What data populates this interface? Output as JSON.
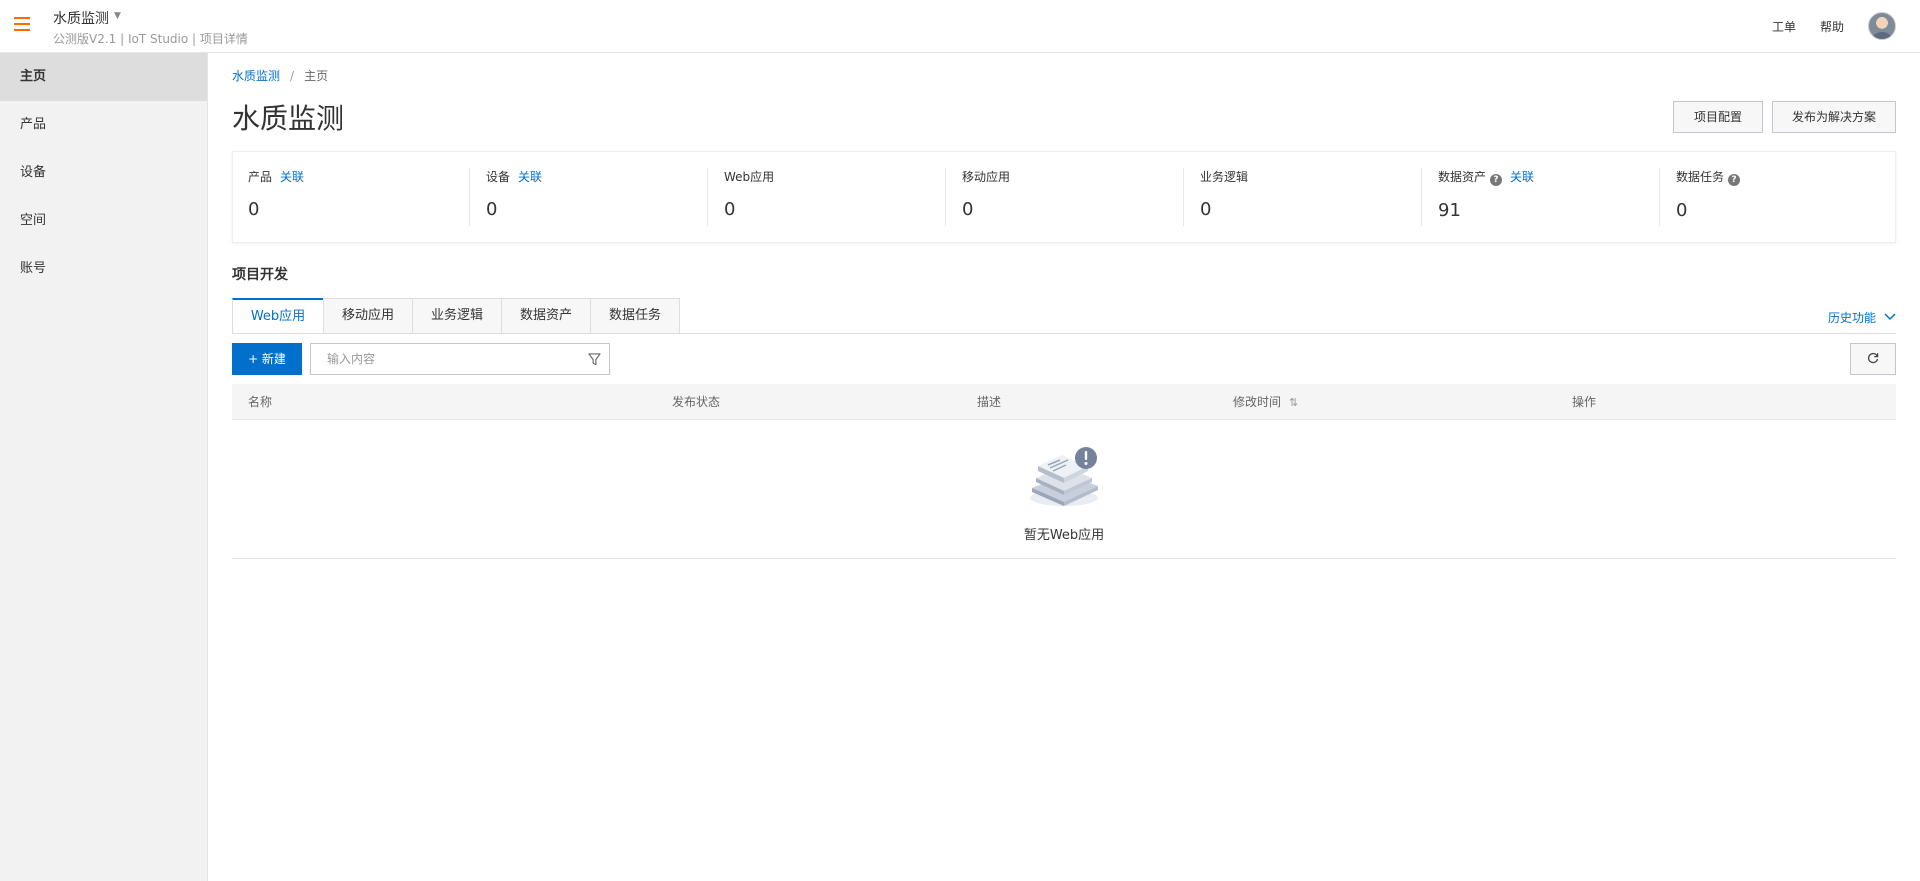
{
  "header": {
    "project_name": "水质监测",
    "project_subtitle": "公测版V2.1 | IoT Studio | 项目详情",
    "ticket_label": "工单",
    "help_label": "帮助",
    "brand_color": "#ff6a00"
  },
  "sidebar": {
    "items": [
      {
        "label": "主页",
        "active": true
      },
      {
        "label": "产品"
      },
      {
        "label": "设备"
      },
      {
        "label": "空间"
      },
      {
        "label": "账号"
      }
    ]
  },
  "breadcrumb": {
    "parent": "水质监测",
    "separator": "/",
    "current": "主页"
  },
  "page": {
    "title": "水质监测",
    "config_button": "项目配置",
    "publish_button": "发布为解决方案"
  },
  "stats": [
    {
      "label": "产品",
      "link": "关联",
      "value": "0"
    },
    {
      "label": "设备",
      "link": "关联",
      "value": "0"
    },
    {
      "label": "Web应用",
      "value": "0"
    },
    {
      "label": "移动应用",
      "value": "0"
    },
    {
      "label": "业务逻辑",
      "value": "0"
    },
    {
      "label": "数据资产",
      "help": true,
      "link": "关联",
      "value": "91"
    },
    {
      "label": "数据任务",
      "help": true,
      "value": "0"
    }
  ],
  "development": {
    "section_title": "项目开发",
    "tabs": [
      "Web应用",
      "移动应用",
      "业务逻辑",
      "数据资产",
      "数据任务"
    ],
    "active_tab": "Web应用",
    "history_label": "历史功能",
    "new_button": "+ 新建",
    "search_placeholder": "输入内容",
    "table": {
      "columns": [
        "名称",
        "发布状态",
        "描述",
        "修改时间",
        "操作"
      ],
      "rows": [],
      "empty_text": "暂无Web应用"
    }
  },
  "colors": {
    "accent": "#0070cc",
    "sidebar_bg": "#f2f2f2",
    "sidebar_active": "#dddddd"
  },
  "icons": {
    "menu": "hamburger-menu-icon",
    "caret": "caret-down-icon",
    "help": "question-circle-icon",
    "filter": "filter-icon",
    "refresh": "refresh-icon",
    "sort": "sort-icon",
    "chevron": "chevron-down-icon",
    "empty": "empty-state-icon"
  }
}
